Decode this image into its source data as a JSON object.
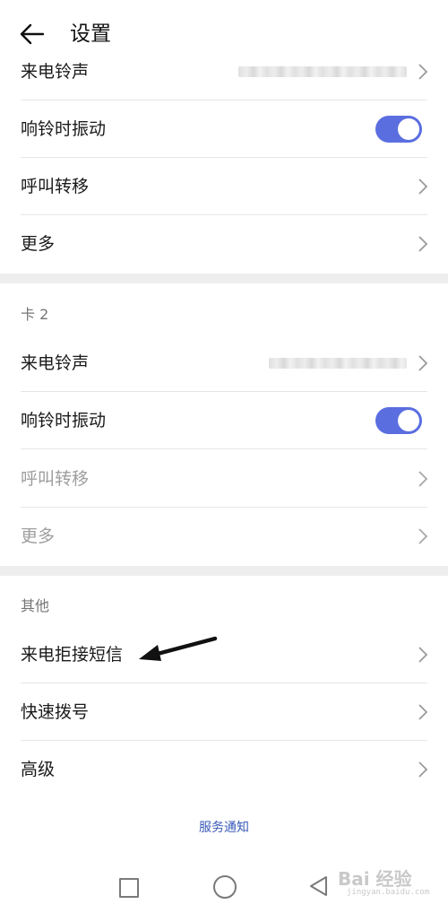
{
  "header": {
    "title": "设置",
    "back_icon": "arrow-left-icon"
  },
  "section_card1": {
    "rows": [
      {
        "label": "来电铃声",
        "type": "value-chevron",
        "value": ""
      },
      {
        "label": "响铃时振动",
        "type": "toggle",
        "toggle_on": true
      },
      {
        "label": "呼叫转移",
        "type": "chevron"
      },
      {
        "label": "更多",
        "type": "chevron"
      }
    ]
  },
  "section_card2": {
    "header": "卡 2",
    "rows": [
      {
        "label": "来电铃声",
        "type": "value-chevron",
        "value": ""
      },
      {
        "label": "响铃时振动",
        "type": "toggle",
        "toggle_on": true
      },
      {
        "label": "呼叫转移",
        "type": "chevron",
        "disabled": true
      },
      {
        "label": "更多",
        "type": "chevron",
        "disabled": true
      }
    ]
  },
  "section_other": {
    "header": "其他",
    "rows": [
      {
        "label": "来电拒接短信",
        "type": "chevron",
        "annotated": true
      },
      {
        "label": "快速拨号",
        "type": "chevron"
      },
      {
        "label": "高级",
        "type": "chevron"
      }
    ]
  },
  "footer": {
    "link": "服务通知"
  },
  "navbar": {
    "recent_icon": "square-icon",
    "home_icon": "circle-icon",
    "back_icon": "triangle-back-icon"
  },
  "watermark": {
    "text": "Bai 经验",
    "sub": "jingyan.baidu.com"
  },
  "colors": {
    "accent": "#5a6ee0",
    "link": "#3a5bb8",
    "section_gap": "#eeeeee",
    "disabled_text": "#9e9e9e"
  }
}
